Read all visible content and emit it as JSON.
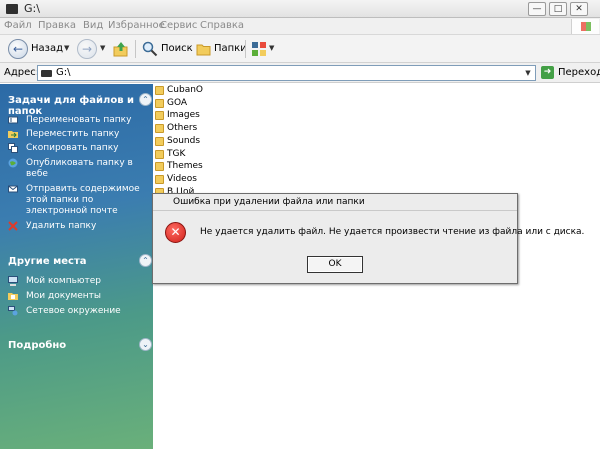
{
  "window": {
    "title": "G:\\"
  },
  "menu": [
    "Файл",
    "Правка",
    "Вид",
    "Избранное",
    "Сервис",
    "Справка"
  ],
  "toolbar": {
    "back_label": "Назад",
    "search_label": "Поиск",
    "folders_label": "Папки"
  },
  "address": {
    "label": "Адрес:",
    "value": "G:\\",
    "go_label": "Переход"
  },
  "tasks": {
    "file_tasks": {
      "title": "Задачи для файлов и папок",
      "items": [
        "Переименовать папку",
        "Переместить папку",
        "Скопировать папку",
        "Опубликовать папку в вебе",
        "Отправить содержимое этой папки по электронной почте",
        "Удалить папку"
      ]
    },
    "other_places": {
      "title": "Другие места",
      "items": [
        "Мой компьютер",
        "Мои документы",
        "Сетевое окружение"
      ]
    },
    "details": {
      "title": "Подробно"
    }
  },
  "folders": [
    "CubanO",
    "GOA",
    "Images",
    "Others",
    "Sounds",
    "TGK",
    "Themes",
    "Videos",
    "В.Цой"
  ],
  "dialog": {
    "title": "Ошибка при удалении файла или папки",
    "message": "Не удается удалить файл. Не удается произвести чтение из файла или с диска.",
    "ok_label": "OK"
  },
  "colors": {
    "taskpane_top": "#2c6aa6",
    "taskpane_bottom": "#6ab07a",
    "error_red": "#d0211b",
    "folder_yellow": "#f2cc5c",
    "go_green": "#43a046"
  }
}
